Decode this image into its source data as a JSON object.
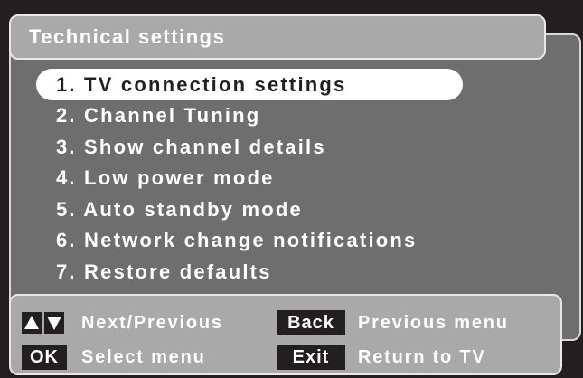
{
  "title": "Technical settings",
  "menu": {
    "items": [
      {
        "label": "1. TV connection settings"
      },
      {
        "label": "2. Channel Tuning"
      },
      {
        "label": "3. Show channel details"
      },
      {
        "label": "4. Low power mode"
      },
      {
        "label": "5. Auto standby mode"
      },
      {
        "label": "6. Network change notifications"
      },
      {
        "label": "7. Restore defaults"
      }
    ],
    "selected_index": 0
  },
  "footer": {
    "up_down_icon": "up-down-arrow-keys",
    "next_previous_label": "Next/Previous",
    "back_key": "Back",
    "back_label": "Previous menu",
    "ok_key": "OK",
    "ok_label": "Select menu",
    "exit_key": "Exit",
    "exit_label": "Return to TV"
  },
  "colors": {
    "background": "#231f20",
    "panel": "#6e6e6e",
    "title_bar": "#a9a9a9",
    "highlight": "#ffffff",
    "text": "#ffffff"
  }
}
